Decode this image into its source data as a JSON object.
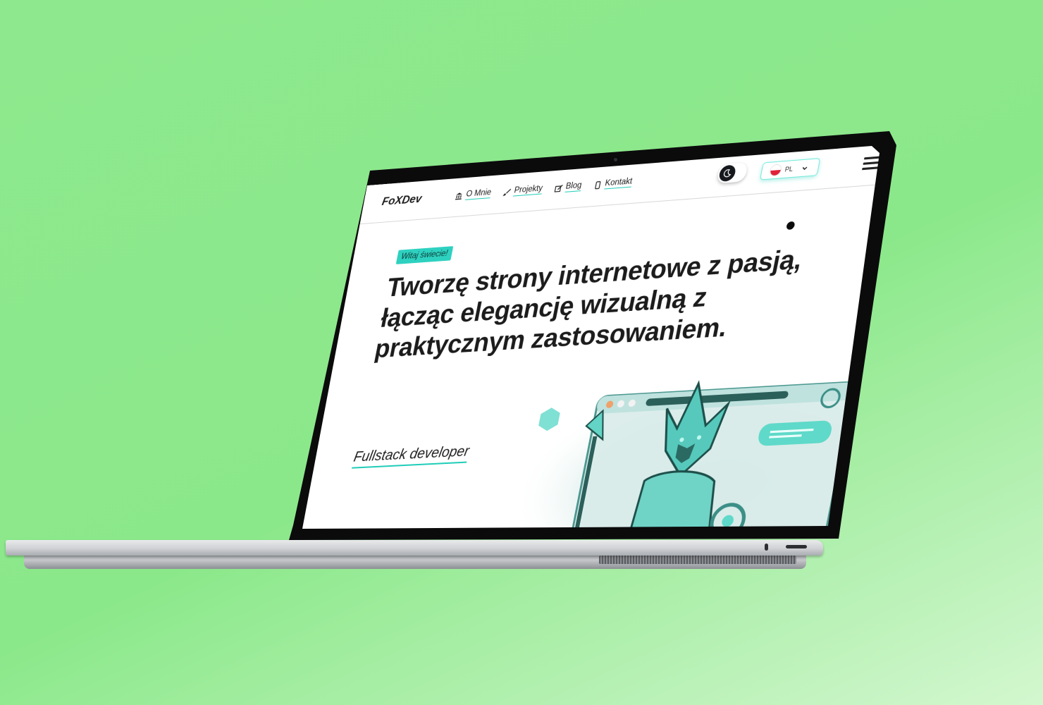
{
  "colors": {
    "background": "#8be88a",
    "accent": "#20cdb8",
    "badge": "#2ed1c0",
    "text": "#1c1c1c"
  },
  "site": {
    "logo": "FoXDev",
    "nav": [
      {
        "label": "O Mnie",
        "icon": "bank-icon"
      },
      {
        "label": "Projekty",
        "icon": "brush-icon"
      },
      {
        "label": "Blog",
        "icon": "edit-icon"
      },
      {
        "label": "Kontakt",
        "icon": "phone-icon"
      }
    ],
    "theme_toggle_icon": "moon-icon",
    "language": {
      "code": "PL",
      "flag": "poland-flag-icon"
    },
    "menu_icon": "hamburger-icon"
  },
  "hero": {
    "badge": "Witaj świecie!",
    "title": "Tworzę strony internetowe z pasją, łącząc elegancję wizualną z praktycznym zastosowaniem.",
    "role": "Fullstack developer",
    "illustration": "robot-fox-illustration"
  }
}
